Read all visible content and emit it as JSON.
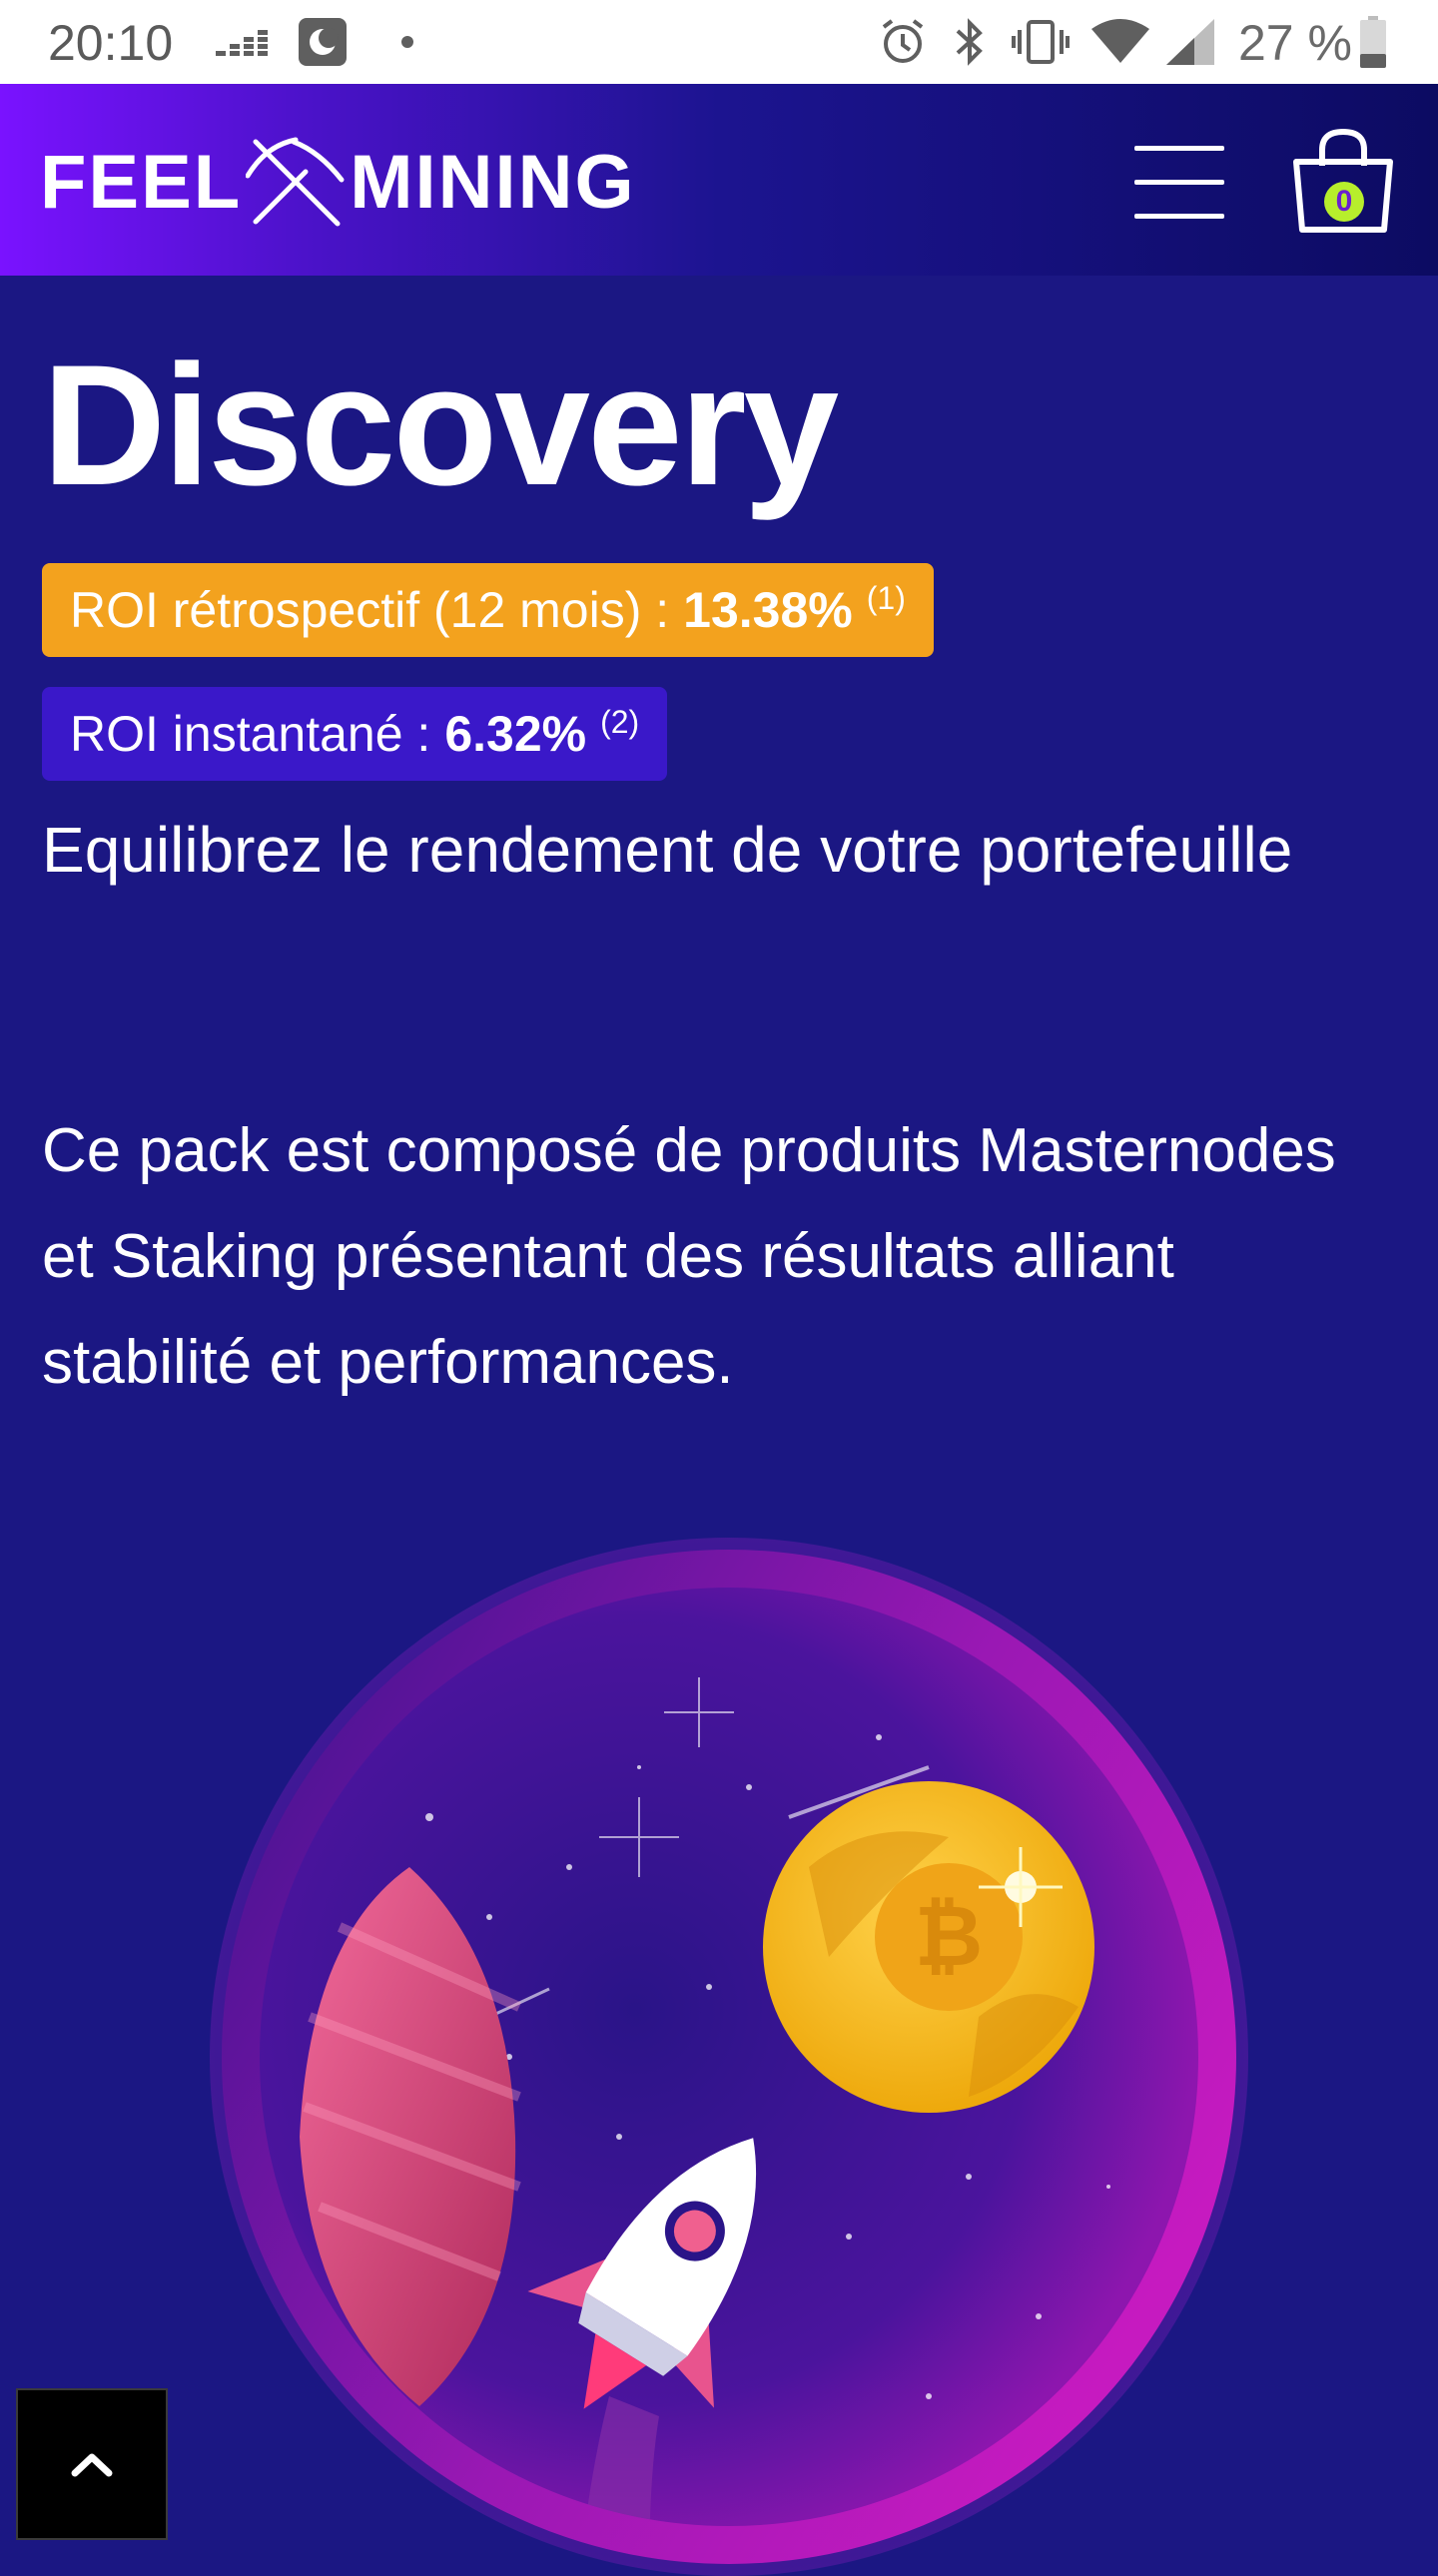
{
  "status_bar": {
    "time": "20:10",
    "battery_text": "27 %",
    "icons": [
      "deezer-icon",
      "app-icon",
      "dot-icon",
      "alarm-icon",
      "bluetooth-icon",
      "vibrate-icon",
      "wifi-icon",
      "signal-icon",
      "battery-icon"
    ]
  },
  "header": {
    "logo_left": "FEEL",
    "logo_right": "MINING",
    "cart_count": "0"
  },
  "main": {
    "title": "Discovery",
    "roi_retro": {
      "label": "ROI rétrospectif (12 mois) :",
      "value": "13.38%",
      "note": "(1)"
    },
    "roi_instant": {
      "label": "ROI instantané :",
      "value": "6.32%",
      "note": "(2)"
    },
    "subtitle": "Equilibrez le rendement de votre portefeuille",
    "description": "Ce pack est composé de produits Masternodes et Staking présentant des résultats alliant stabilité et performances."
  },
  "colors": {
    "background": "#1b1783",
    "orange_badge": "#f3a21e",
    "purple_badge": "#3a18c9",
    "cart_badge": "#b7ee2c"
  }
}
